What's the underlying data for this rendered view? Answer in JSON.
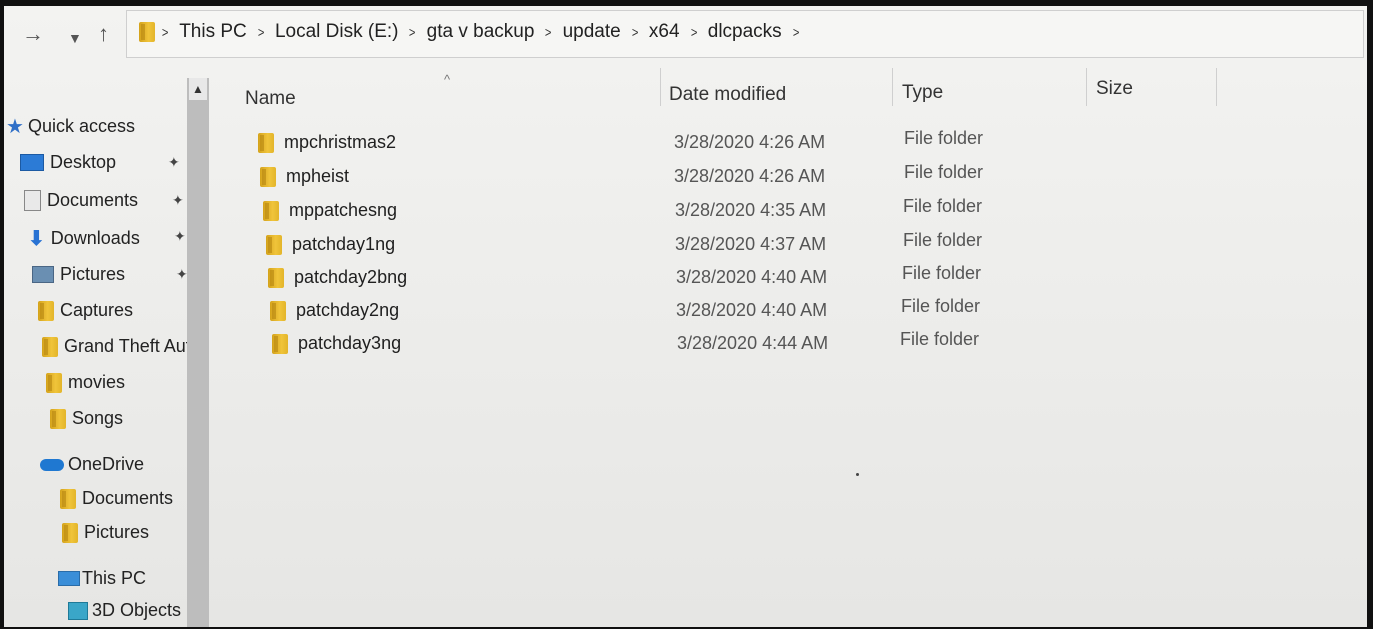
{
  "breadcrumb": [
    "This PC",
    "Local Disk (E:)",
    "gta v backup",
    "update",
    "x64",
    "dlcpacks"
  ],
  "nav": {
    "back_icon": "back-arrow-icon",
    "recent_icon": "chevron-down-icon",
    "up_icon": "up-arrow-icon"
  },
  "sidebar": {
    "quick_access": "Quick access",
    "desktop": "Desktop",
    "documents": "Documents",
    "downloads": "Downloads",
    "pictures": "Pictures",
    "captures": "Captures",
    "gta": "Grand Theft Auto",
    "movies": "movies",
    "songs": "Songs",
    "onedrive": "OneDrive",
    "od_documents": "Documents",
    "od_pictures": "Pictures",
    "this_pc": "This PC",
    "objects_3d": "3D Objects"
  },
  "columns": {
    "name": "Name",
    "date": "Date modified",
    "type": "Type",
    "size": "Size"
  },
  "files": [
    {
      "name": "mpchristmas2",
      "date": "3/28/2020 4:26 AM",
      "type": "File folder"
    },
    {
      "name": "mpheist",
      "date": "3/28/2020 4:26 AM",
      "type": "File folder"
    },
    {
      "name": "mppatchesng",
      "date": "3/28/2020 4:35 AM",
      "type": "File folder"
    },
    {
      "name": "patchday1ng",
      "date": "3/28/2020 4:37 AM",
      "type": "File folder"
    },
    {
      "name": "patchday2bng",
      "date": "3/28/2020 4:40 AM",
      "type": "File folder"
    },
    {
      "name": "patchday2ng",
      "date": "3/28/2020 4:40 AM",
      "type": "File folder"
    },
    {
      "name": "patchday3ng",
      "date": "3/28/2020 4:44 AM",
      "type": "File folder"
    }
  ],
  "colors": {
    "folder": "#f0c43a",
    "accent": "#2f6fc7"
  }
}
